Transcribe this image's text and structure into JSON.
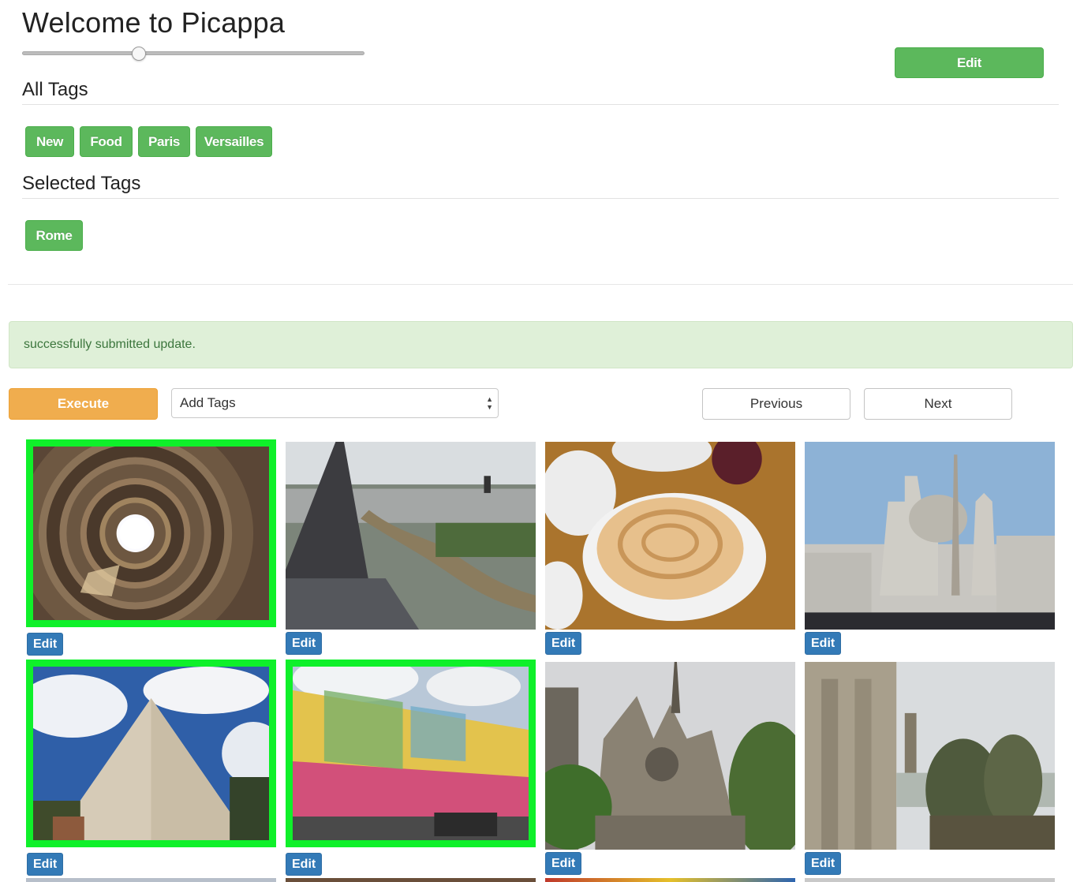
{
  "header": {
    "title": "Welcome to Picappa",
    "slider_value": 0.34,
    "edit_label": "Edit"
  },
  "all_tags": {
    "heading": "All Tags",
    "tags": [
      "New",
      "Food",
      "Paris",
      "Versailles"
    ]
  },
  "selected_tags": {
    "heading": "Selected Tags",
    "tags": [
      "Rome"
    ]
  },
  "alert": {
    "message": "successfully submitted update."
  },
  "toolbar": {
    "execute_label": "Execute",
    "action_select_value": "Add Tags",
    "previous_label": "Previous",
    "next_label": "Next"
  },
  "photos": [
    {
      "subject": "pantheon-dome",
      "selected": true,
      "edit_label": "Edit"
    },
    {
      "subject": "paris-river-view",
      "selected": false,
      "edit_label": "Edit"
    },
    {
      "subject": "crepe-plate",
      "selected": false,
      "edit_label": "Edit"
    },
    {
      "subject": "piazza-navona",
      "selected": false,
      "edit_label": "Edit"
    },
    {
      "subject": "pyramid-cestius",
      "selected": true,
      "edit_label": "Edit"
    },
    {
      "subject": "painted-building",
      "selected": true,
      "edit_label": "Edit"
    },
    {
      "subject": "notre-dame-facade",
      "selected": false,
      "edit_label": "Edit"
    },
    {
      "subject": "gargoyle",
      "selected": false,
      "edit_label": "Edit"
    }
  ],
  "colors": {
    "success": "#5cb85c",
    "warning": "#f0ad4e",
    "primary": "#337ab7",
    "selection": "#0ff02a",
    "alert_bg": "#dff0d8",
    "alert_text": "#3c763d"
  }
}
